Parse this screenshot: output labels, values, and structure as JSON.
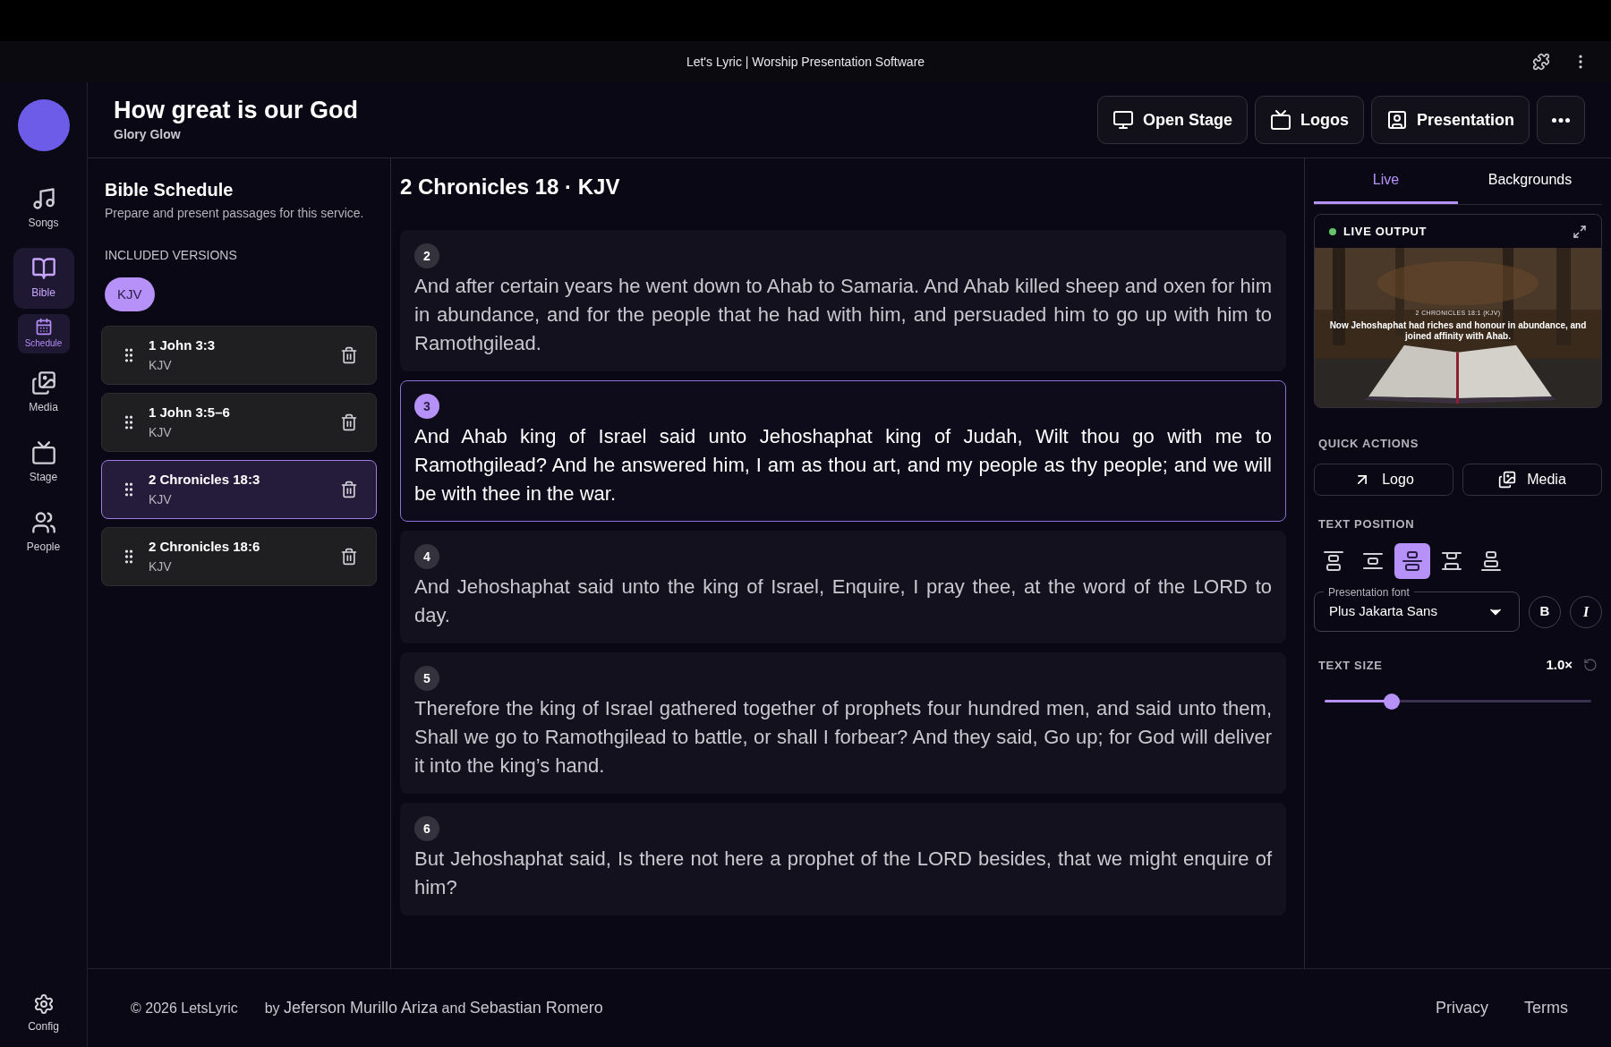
{
  "titlebar": {
    "title": "Let's Lyric | Worship Presentation Software"
  },
  "nav": {
    "items": [
      {
        "label": "Songs",
        "kind": "songs",
        "selected": false
      },
      {
        "label": "Bible",
        "kind": "bible",
        "selected": true,
        "children": [
          {
            "label": "Schedule",
            "kind": "schedule",
            "selected": true
          }
        ]
      },
      {
        "label": "Media",
        "kind": "media",
        "selected": false
      },
      {
        "label": "Stage",
        "kind": "stage",
        "selected": false
      },
      {
        "label": "People",
        "kind": "people",
        "selected": false
      }
    ],
    "config": {
      "label": "Config"
    }
  },
  "header": {
    "title": "How great is our God",
    "subtitle": "Glory Glow",
    "buttons": [
      {
        "label": "Open Stage",
        "kind": "monitor"
      },
      {
        "label": "Logos",
        "kind": "tv"
      },
      {
        "label": "Presentation",
        "kind": "person"
      }
    ]
  },
  "schedule": {
    "title": "Bible Schedule",
    "description": "Prepare and present passages for this service.",
    "versions_heading": "INCLUDED VERSIONS",
    "versions": [
      {
        "label": "KJV",
        "selected": true
      }
    ],
    "passages": [
      {
        "reference": "1 John 3:3",
        "version": "KJV",
        "selected": false
      },
      {
        "reference": "1 John 3:5–6",
        "version": "KJV",
        "selected": false
      },
      {
        "reference": "2 Chronicles 18:3",
        "version": "KJV",
        "selected": true
      },
      {
        "reference": "2 Chronicles 18:6",
        "version": "KJV",
        "selected": false
      }
    ]
  },
  "reader": {
    "heading": "2 Chronicles 18 · KJV",
    "verses": [
      {
        "number": "2",
        "text": "And after certain years he went down to Ahab to Samaria. And Ahab killed sheep and oxen for him in abundance, and for the people that he had with him, and persuaded him to go up with him to Ramothgilead.",
        "selected": false
      },
      {
        "number": "3",
        "text": "And Ahab king of Israel said unto Jehoshaphat king of Judah, Wilt thou go with me to Ramothgilead? And he answered him, I am as thou art, and my people as thy people; and we will be with thee in the war.",
        "selected": true
      },
      {
        "number": "4",
        "text": "And Jehoshaphat said unto the king of Israel, Enquire, I pray thee, at the word of the LORD to day.",
        "selected": false
      },
      {
        "number": "5",
        "text": "Therefore the king of Israel gathered together of prophets four hundred men, and said unto them, Shall we go to Ramothgilead to battle, or shall I forbear? And they said, Go up; for God will deliver it into the king’s hand.",
        "selected": false
      },
      {
        "number": "6",
        "text": "But Jehoshaphat said, Is there not here a prophet of the LORD besides, that we might enquire of him?",
        "selected": false
      }
    ]
  },
  "panel": {
    "tabs": [
      {
        "label": "Live",
        "selected": true
      },
      {
        "label": "Backgrounds",
        "selected": false
      }
    ],
    "live_output": {
      "label": "LIVE OUTPUT",
      "live": true,
      "preview": {
        "kind": "picture",
        "reference": "2 CHRONICLES 18:1 (KJV)",
        "text": "Now Jehoshaphat had riches and honour in abundance, and joined affinity with Ahab."
      }
    },
    "quick_actions": {
      "heading": "QUICK ACTIONS",
      "buttons": [
        {
          "label": "Logo",
          "kind": "logo"
        },
        {
          "label": "Media",
          "kind": "media"
        }
      ]
    },
    "text_position": {
      "heading": "TEXT POSITION",
      "options": [
        {
          "selected": false
        },
        {
          "selected": false
        },
        {
          "selected": true
        },
        {
          "selected": false
        },
        {
          "selected": false
        }
      ]
    },
    "font": {
      "label": "Presentation font",
      "value": "Plus Jakarta Sans",
      "bold_label": "B",
      "italic_label": "I"
    },
    "text_size": {
      "heading": "TEXT SIZE",
      "reading": "1.0×",
      "level": 0.25
    }
  },
  "footer": {
    "copyright": "© 2026 LetsLyric",
    "by": "by",
    "authors": [
      "Jeferson Murillo Ariza",
      "Sebastian Romero"
    ],
    "conjunction": "and",
    "links": [
      "Privacy",
      "Terms"
    ]
  }
}
